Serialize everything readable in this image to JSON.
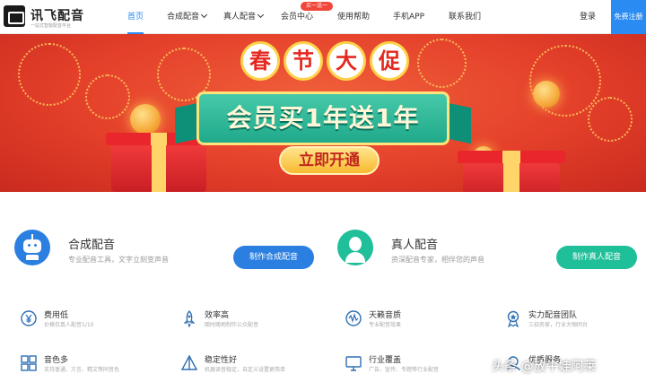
{
  "header": {
    "logo_name": "讯飞配音",
    "logo_tagline": "一站式智能配音平台",
    "nav": [
      {
        "label": "首页",
        "active": true,
        "dropdown": false
      },
      {
        "label": "合成配音",
        "active": false,
        "dropdown": true
      },
      {
        "label": "真人配音",
        "active": false,
        "dropdown": true
      },
      {
        "label": "会员中心",
        "active": false,
        "dropdown": false
      },
      {
        "label": "使用帮助",
        "active": false,
        "dropdown": false
      },
      {
        "label": "手机APP",
        "active": false,
        "dropdown": false
      },
      {
        "label": "联系我们",
        "active": false,
        "dropdown": false
      }
    ],
    "member_badge": "买一送一",
    "login_label": "登录",
    "register_label": "免费注册"
  },
  "banner": {
    "headline_chars": [
      "春",
      "节",
      "大",
      "促"
    ],
    "offer": "会员买1年送1年",
    "cta": "立即开通",
    "colors": {
      "background": "#e4402a",
      "ribbon": "#2bb394",
      "gold": "#ffd24a"
    }
  },
  "services": [
    {
      "title": "合成配音",
      "subtitle": "专业配音工具，文字立刻变声音",
      "button": "制作合成配音",
      "icon": "robot-icon",
      "accent": "#2a7fe0"
    },
    {
      "title": "真人配音",
      "subtitle": "资深配音专家，相伴您的声音",
      "button": "制作真人配音",
      "icon": "person-icon",
      "accent": "#1fbf9a"
    }
  ],
  "features": [
    {
      "title": "费用低",
      "subtitle": "价格仅真人配音1/10",
      "icon": "yen-icon"
    },
    {
      "title": "效率高",
      "subtitle": "随时随地制作公众配音",
      "icon": "rocket-icon"
    },
    {
      "title": "天籁音质",
      "subtitle": "专业配音效果",
      "icon": "sound-wave-icon"
    },
    {
      "title": "实力配音团队",
      "subtitle": "三招名家，行业大咖同台",
      "icon": "award-medal-icon"
    },
    {
      "title": "音色多",
      "subtitle": "支持普通、方言、精文等同音色",
      "icon": "grid-icon"
    },
    {
      "title": "稳定性好",
      "subtitle": "机器读音稳定，自定义设置更简单",
      "icon": "pyramid-icon"
    },
    {
      "title": "行业覆盖",
      "subtitle": "广告、宣传、专题等行业配音",
      "icon": "monitor-icon"
    },
    {
      "title": "优质服务",
      "subtitle": "",
      "icon": "service-icon"
    }
  ],
  "watermark": "头条 @放牛娃阿莱"
}
